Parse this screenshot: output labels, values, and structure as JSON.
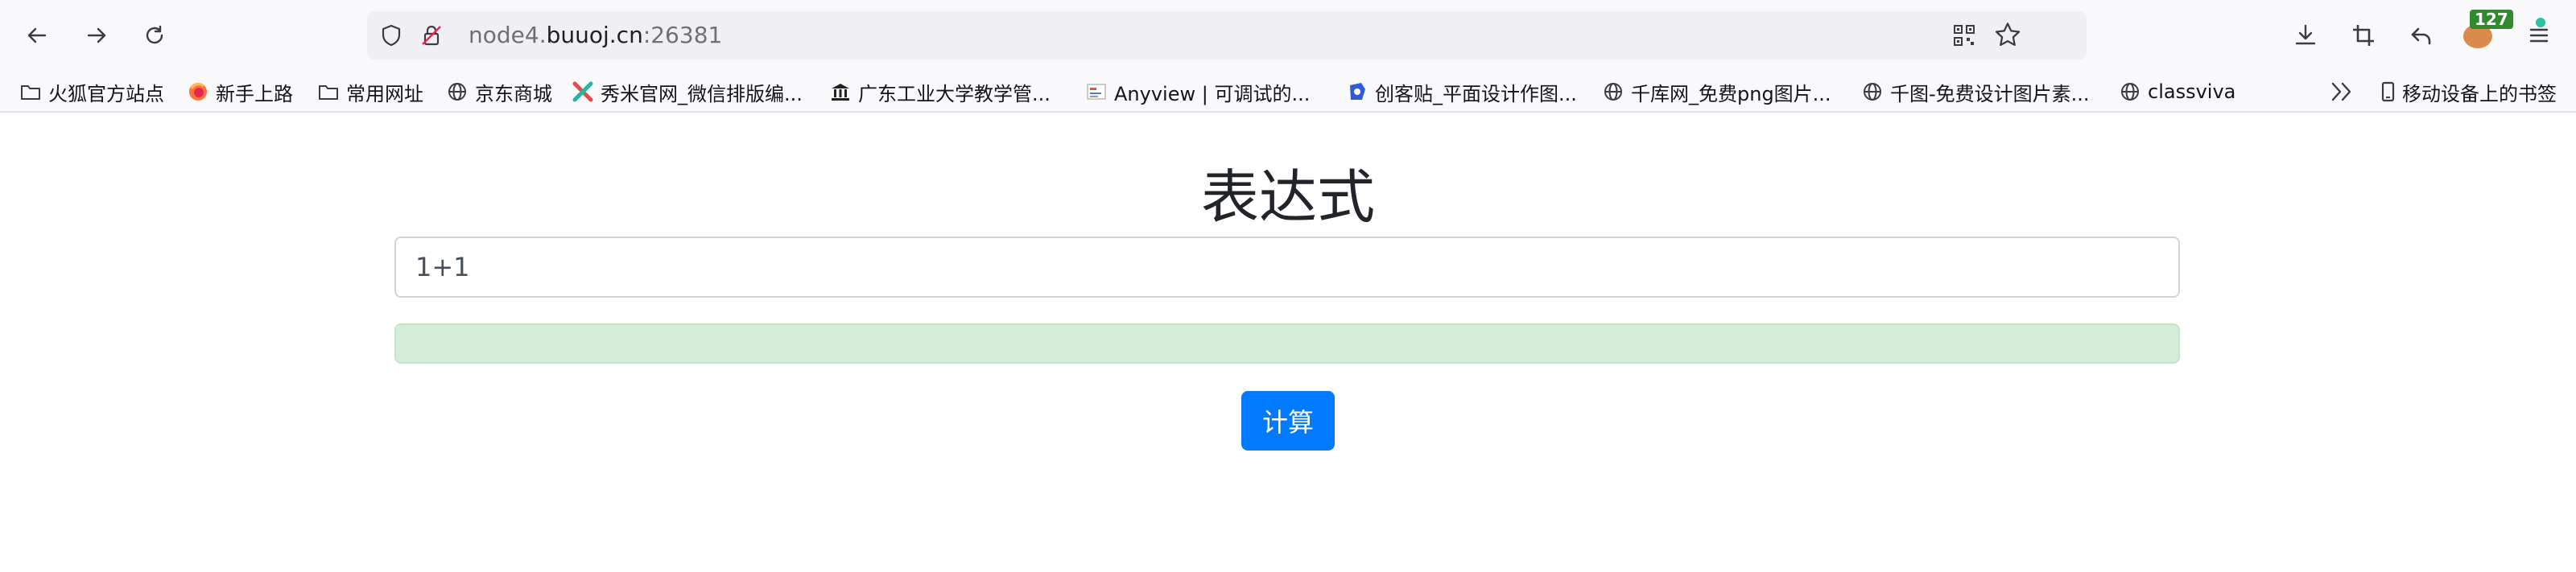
{
  "browser": {
    "url": {
      "prefix": "node4.",
      "domain": "buuoj.cn",
      "port": ":26381"
    },
    "extension_badge": "127",
    "bookmarks": [
      {
        "icon": "folder-icon",
        "label": "火狐官方站点"
      },
      {
        "icon": "firefox-icon",
        "label": "新手上路"
      },
      {
        "icon": "folder-icon",
        "label": "常用网址"
      },
      {
        "icon": "globe-icon",
        "label": "京东商城"
      },
      {
        "icon": "xiumi-icon",
        "label": "秀米官网_微信排版编..."
      },
      {
        "icon": "university-icon",
        "label": "广东工业大学教学管..."
      },
      {
        "icon": "anyview-icon",
        "label": "Anyview | 可调试的..."
      },
      {
        "icon": "chuangke-icon",
        "label": "创客贴_平面设计作图..."
      },
      {
        "icon": "globe-icon",
        "label": "千库网_免费png图片..."
      },
      {
        "icon": "globe-icon",
        "label": "千图-免费设计图片素..."
      },
      {
        "icon": "globe-icon",
        "label": "classviva"
      }
    ],
    "mobile_bookmarks_label": "移动设备上的书签"
  },
  "page": {
    "title": "表达式",
    "expression_input_value": "1+1",
    "result_text": "",
    "calculate_button_label": "计算"
  },
  "colors": {
    "primary": "#007bff",
    "success_bg": "#d4edda",
    "success_border": "#c3e6cb"
  }
}
